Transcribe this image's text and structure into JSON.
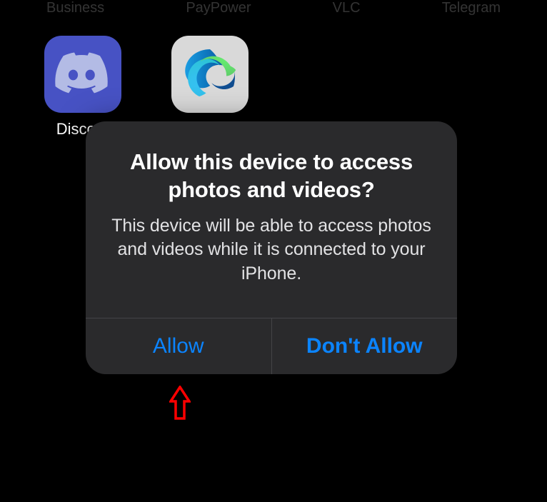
{
  "top_labels": [
    "Business",
    "PayPower",
    "VLC",
    "Telegram"
  ],
  "apps": [
    {
      "name": "Discord",
      "label": "Discord"
    },
    {
      "name": "Edge",
      "label": ""
    }
  ],
  "alert": {
    "title": "Allow this device to access photos and videos?",
    "message": "This device will be able to access photos and videos while it is connected to your iPhone.",
    "buttons": {
      "allow": "Allow",
      "deny": "Don't Allow"
    }
  },
  "colors": {
    "discord_bg": "#4752c4",
    "edge_bg": "#d9d9d9",
    "alert_bg": "#2a2a2c",
    "ios_blue": "#0b84ff"
  }
}
